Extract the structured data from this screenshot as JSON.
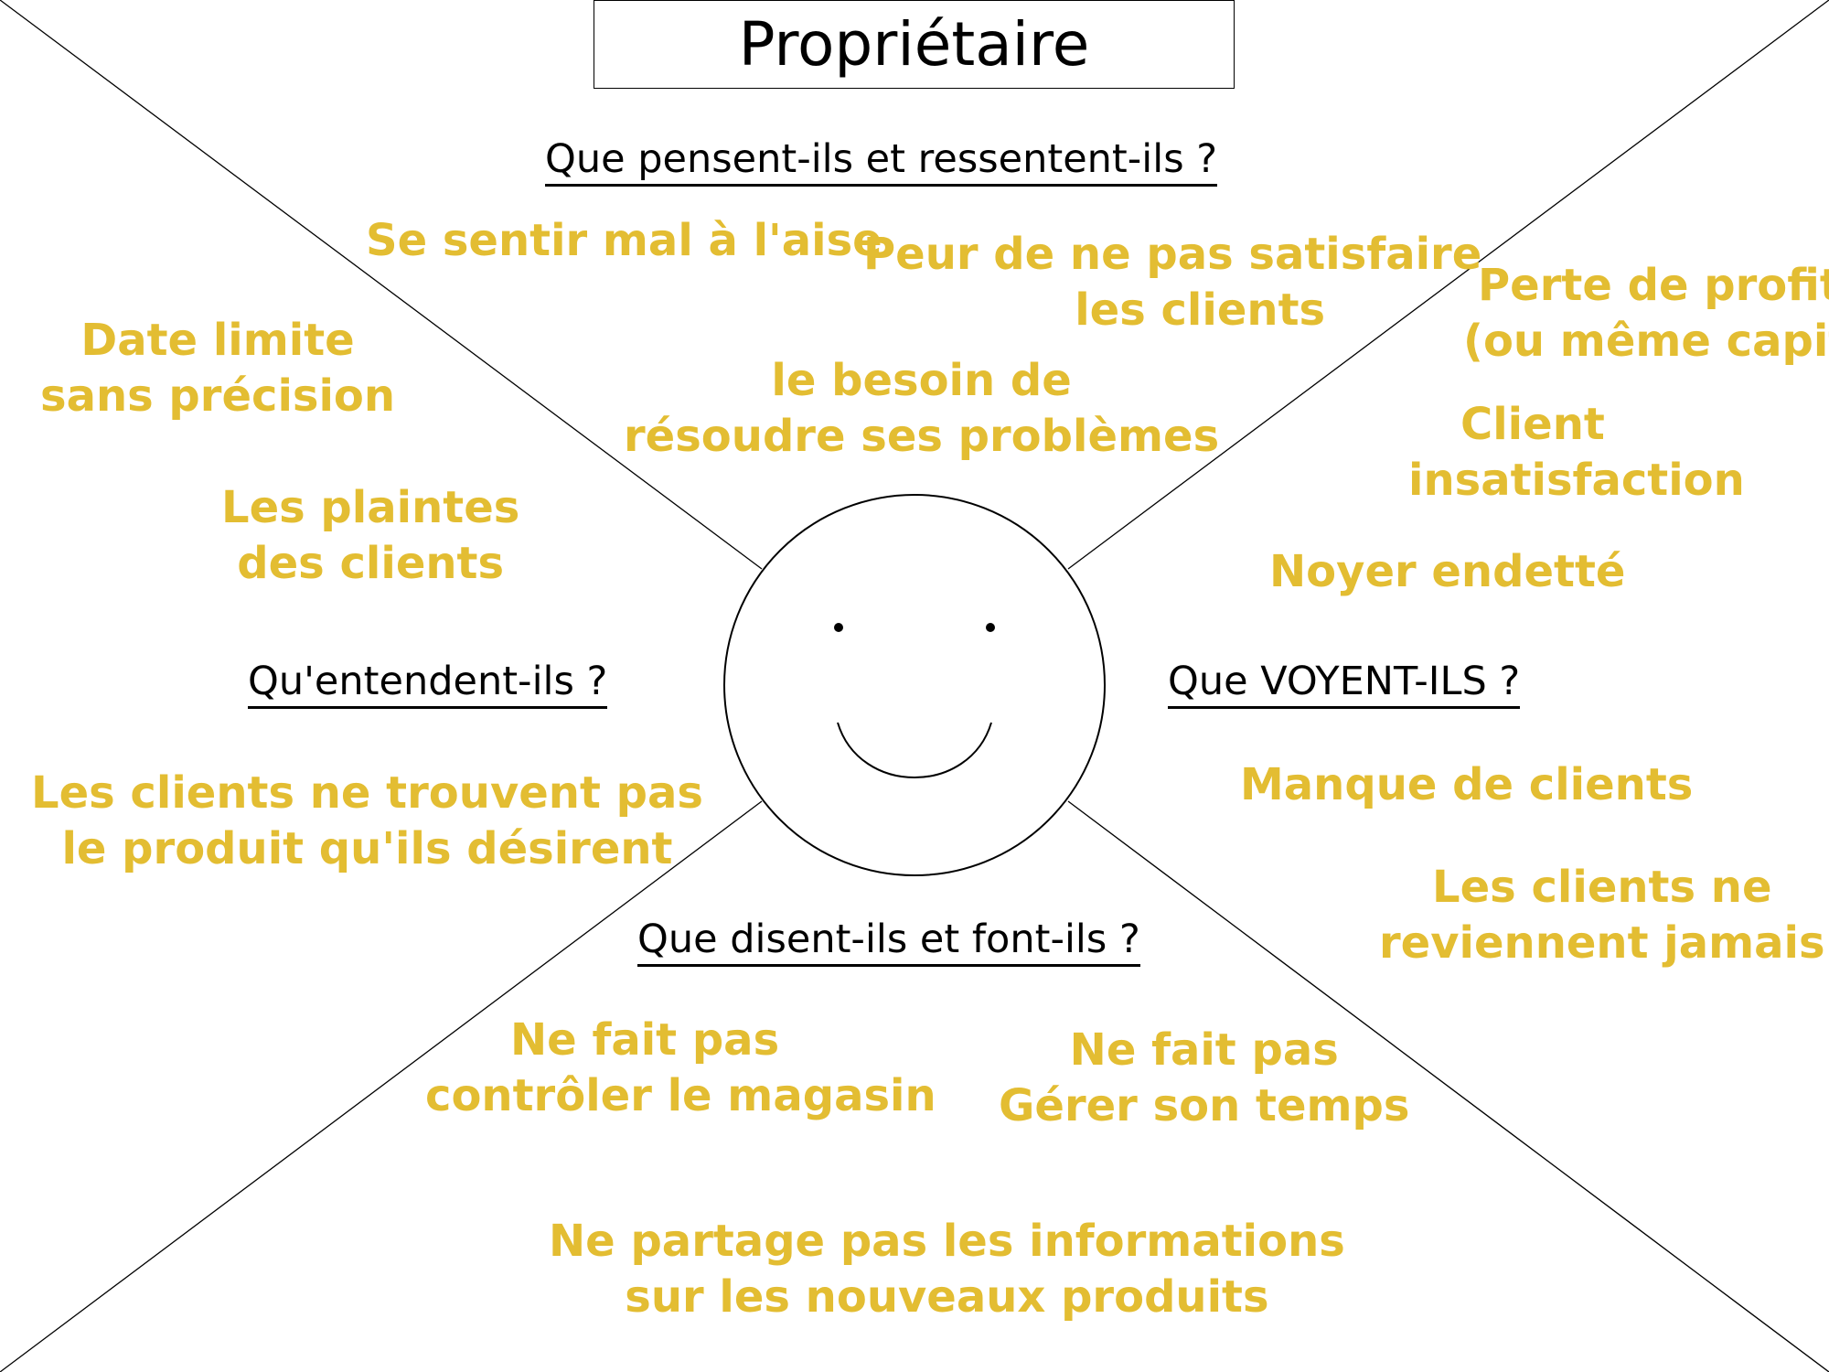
{
  "title": "Propriétaire",
  "colors": {
    "note": "#e3bd32",
    "lines": "#000000"
  },
  "headings": {
    "think_feel": "Que pensent-ils et ressentent-ils ?",
    "hear": "Qu'entendent-ils ?",
    "see": "Que VOYENT-ILS ?",
    "say_do": "Que disent-ils et font-ils ?"
  },
  "notes": {
    "mal_aise": [
      "Se sentir mal à l'aise"
    ],
    "peur": [
      "Peur de ne pas satisfaire",
      "les clients"
    ],
    "besoin": [
      "le besoin de",
      "résoudre ses problèmes"
    ],
    "date_limite": [
      "Date limite",
      "sans précision"
    ],
    "plaintes": [
      "Les plaintes",
      "des clients"
    ],
    "perte_profit": [
      "Perte de profit",
      "(ou même capita"
    ],
    "client_insat": [
      "Client",
      "insatisfaction"
    ],
    "noyer": [
      "Noyer endetté"
    ],
    "produit_desire": [
      "Les clients ne trouvent pas",
      "le produit qu'ils désirent"
    ],
    "manque_clients": [
      "Manque de clients"
    ],
    "reviennent": [
      "Les clients ne",
      "reviennent jamais"
    ],
    "controler": [
      "Ne fait pas",
      "contrôler le magasin"
    ],
    "temps": [
      "Ne fait pas",
      "Gérer son temps"
    ],
    "partage": [
      "Ne partage pas les informations",
      "sur les nouveaux produits"
    ]
  },
  "face_icon": "smiley-face-icon"
}
